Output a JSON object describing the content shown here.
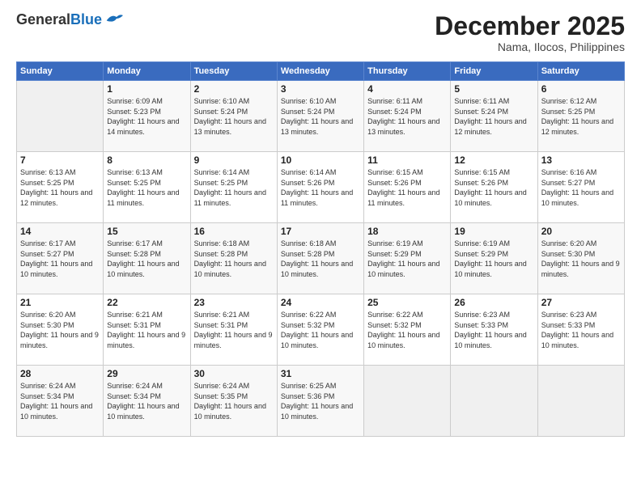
{
  "logo": {
    "general": "General",
    "blue": "Blue"
  },
  "header": {
    "month": "December 2025",
    "location": "Nama, Ilocos, Philippines"
  },
  "weekdays": [
    "Sunday",
    "Monday",
    "Tuesday",
    "Wednesday",
    "Thursday",
    "Friday",
    "Saturday"
  ],
  "weeks": [
    [
      {
        "day": "",
        "empty": true
      },
      {
        "day": "1",
        "sunrise": "6:09 AM",
        "sunset": "5:23 PM",
        "daylight": "11 hours and 14 minutes."
      },
      {
        "day": "2",
        "sunrise": "6:10 AM",
        "sunset": "5:24 PM",
        "daylight": "11 hours and 13 minutes."
      },
      {
        "day": "3",
        "sunrise": "6:10 AM",
        "sunset": "5:24 PM",
        "daylight": "11 hours and 13 minutes."
      },
      {
        "day": "4",
        "sunrise": "6:11 AM",
        "sunset": "5:24 PM",
        "daylight": "11 hours and 13 minutes."
      },
      {
        "day": "5",
        "sunrise": "6:11 AM",
        "sunset": "5:24 PM",
        "daylight": "11 hours and 12 minutes."
      },
      {
        "day": "6",
        "sunrise": "6:12 AM",
        "sunset": "5:25 PM",
        "daylight": "11 hours and 12 minutes."
      }
    ],
    [
      {
        "day": "7",
        "sunrise": "6:13 AM",
        "sunset": "5:25 PM",
        "daylight": "11 hours and 12 minutes."
      },
      {
        "day": "8",
        "sunrise": "6:13 AM",
        "sunset": "5:25 PM",
        "daylight": "11 hours and 11 minutes."
      },
      {
        "day": "9",
        "sunrise": "6:14 AM",
        "sunset": "5:25 PM",
        "daylight": "11 hours and 11 minutes."
      },
      {
        "day": "10",
        "sunrise": "6:14 AM",
        "sunset": "5:26 PM",
        "daylight": "11 hours and 11 minutes."
      },
      {
        "day": "11",
        "sunrise": "6:15 AM",
        "sunset": "5:26 PM",
        "daylight": "11 hours and 11 minutes."
      },
      {
        "day": "12",
        "sunrise": "6:15 AM",
        "sunset": "5:26 PM",
        "daylight": "11 hours and 10 minutes."
      },
      {
        "day": "13",
        "sunrise": "6:16 AM",
        "sunset": "5:27 PM",
        "daylight": "11 hours and 10 minutes."
      }
    ],
    [
      {
        "day": "14",
        "sunrise": "6:17 AM",
        "sunset": "5:27 PM",
        "daylight": "11 hours and 10 minutes."
      },
      {
        "day": "15",
        "sunrise": "6:17 AM",
        "sunset": "5:28 PM",
        "daylight": "11 hours and 10 minutes."
      },
      {
        "day": "16",
        "sunrise": "6:18 AM",
        "sunset": "5:28 PM",
        "daylight": "11 hours and 10 minutes."
      },
      {
        "day": "17",
        "sunrise": "6:18 AM",
        "sunset": "5:28 PM",
        "daylight": "11 hours and 10 minutes."
      },
      {
        "day": "18",
        "sunrise": "6:19 AM",
        "sunset": "5:29 PM",
        "daylight": "11 hours and 10 minutes."
      },
      {
        "day": "19",
        "sunrise": "6:19 AM",
        "sunset": "5:29 PM",
        "daylight": "11 hours and 10 minutes."
      },
      {
        "day": "20",
        "sunrise": "6:20 AM",
        "sunset": "5:30 PM",
        "daylight": "11 hours and 9 minutes."
      }
    ],
    [
      {
        "day": "21",
        "sunrise": "6:20 AM",
        "sunset": "5:30 PM",
        "daylight": "11 hours and 9 minutes."
      },
      {
        "day": "22",
        "sunrise": "6:21 AM",
        "sunset": "5:31 PM",
        "daylight": "11 hours and 9 minutes."
      },
      {
        "day": "23",
        "sunrise": "6:21 AM",
        "sunset": "5:31 PM",
        "daylight": "11 hours and 9 minutes."
      },
      {
        "day": "24",
        "sunrise": "6:22 AM",
        "sunset": "5:32 PM",
        "daylight": "11 hours and 10 minutes."
      },
      {
        "day": "25",
        "sunrise": "6:22 AM",
        "sunset": "5:32 PM",
        "daylight": "11 hours and 10 minutes."
      },
      {
        "day": "26",
        "sunrise": "6:23 AM",
        "sunset": "5:33 PM",
        "daylight": "11 hours and 10 minutes."
      },
      {
        "day": "27",
        "sunrise": "6:23 AM",
        "sunset": "5:33 PM",
        "daylight": "11 hours and 10 minutes."
      }
    ],
    [
      {
        "day": "28",
        "sunrise": "6:24 AM",
        "sunset": "5:34 PM",
        "daylight": "11 hours and 10 minutes."
      },
      {
        "day": "29",
        "sunrise": "6:24 AM",
        "sunset": "5:34 PM",
        "daylight": "11 hours and 10 minutes."
      },
      {
        "day": "30",
        "sunrise": "6:24 AM",
        "sunset": "5:35 PM",
        "daylight": "11 hours and 10 minutes."
      },
      {
        "day": "31",
        "sunrise": "6:25 AM",
        "sunset": "5:36 PM",
        "daylight": "11 hours and 10 minutes."
      },
      {
        "day": "",
        "empty": true
      },
      {
        "day": "",
        "empty": true
      },
      {
        "day": "",
        "empty": true
      }
    ]
  ]
}
